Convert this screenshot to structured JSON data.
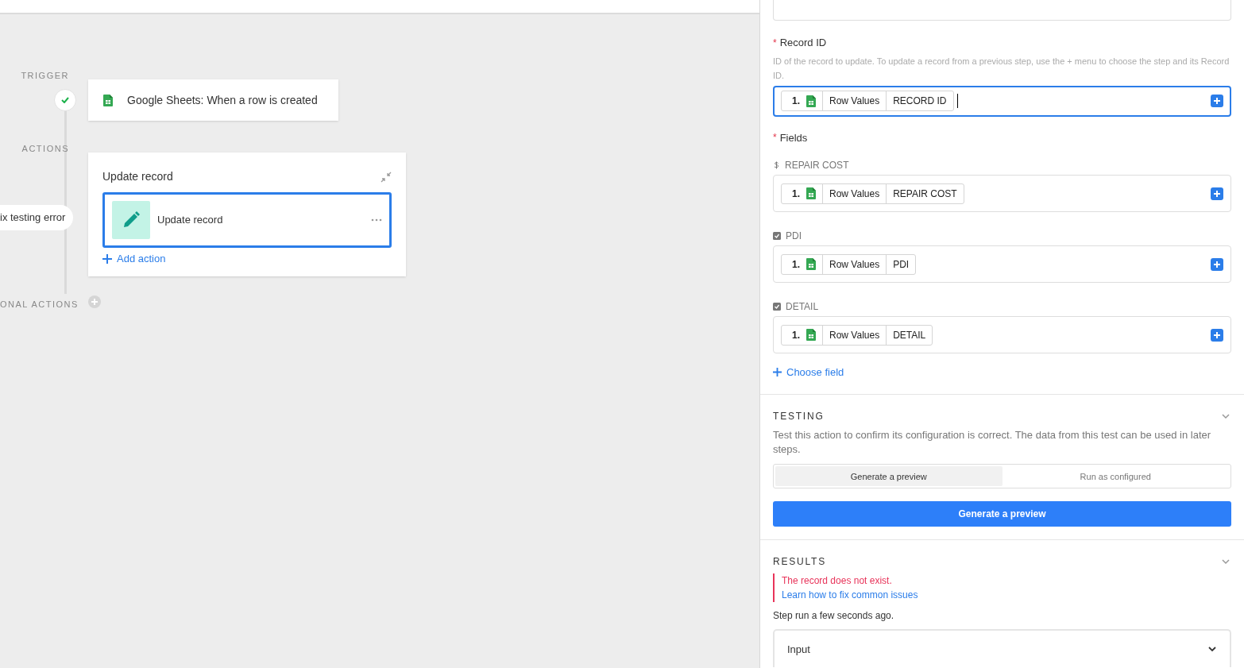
{
  "canvas": {
    "trigger": {
      "section_label": "TRIGGER",
      "title": "Google Sheets: When a row is created",
      "done": true
    },
    "actions": {
      "section_label": "ACTIONS",
      "card_title": "Update record",
      "step": {
        "title": "Update record",
        "selected": true
      },
      "add_label": "Add action"
    },
    "error_pill": "ix testing error",
    "optional_label": "ONAL ACTIONS"
  },
  "panel": {
    "record_id": {
      "label": "Record ID",
      "required_mark": "*",
      "description": "ID of the record to update. To update a record from a previous step, use the + menu to choose the step and its Record ID.",
      "focused": true,
      "tokens": [
        "1.",
        "Row Values",
        "RECORD ID"
      ]
    },
    "fields_label": "Fields",
    "fields_required_mark": "*",
    "fields": [
      {
        "kind": "currency",
        "label": "REPAIR COST",
        "tokens": [
          "1.",
          "Row Values",
          "REPAIR COST"
        ]
      },
      {
        "kind": "boolean",
        "label": "PDI",
        "tokens": [
          "1.",
          "Row Values",
          "PDI"
        ]
      },
      {
        "kind": "boolean",
        "label": "DETAIL",
        "tokens": [
          "1.",
          "Row Values",
          "DETAIL"
        ]
      }
    ],
    "choose_field": "Choose field",
    "testing": {
      "title": "TESTING",
      "description": "Test this action to confirm its configuration is correct. The data from this test can be used in later steps.",
      "tabs": [
        {
          "label": "Generate a preview",
          "selected": true
        },
        {
          "label": "Run as configured",
          "selected": false
        }
      ],
      "button": "Generate a preview"
    },
    "results": {
      "title": "RESULTS",
      "error": "The record does not exist.",
      "link": "Learn how to fix common issues",
      "status": "Step run a few seconds ago.",
      "accordion": "Input"
    }
  }
}
